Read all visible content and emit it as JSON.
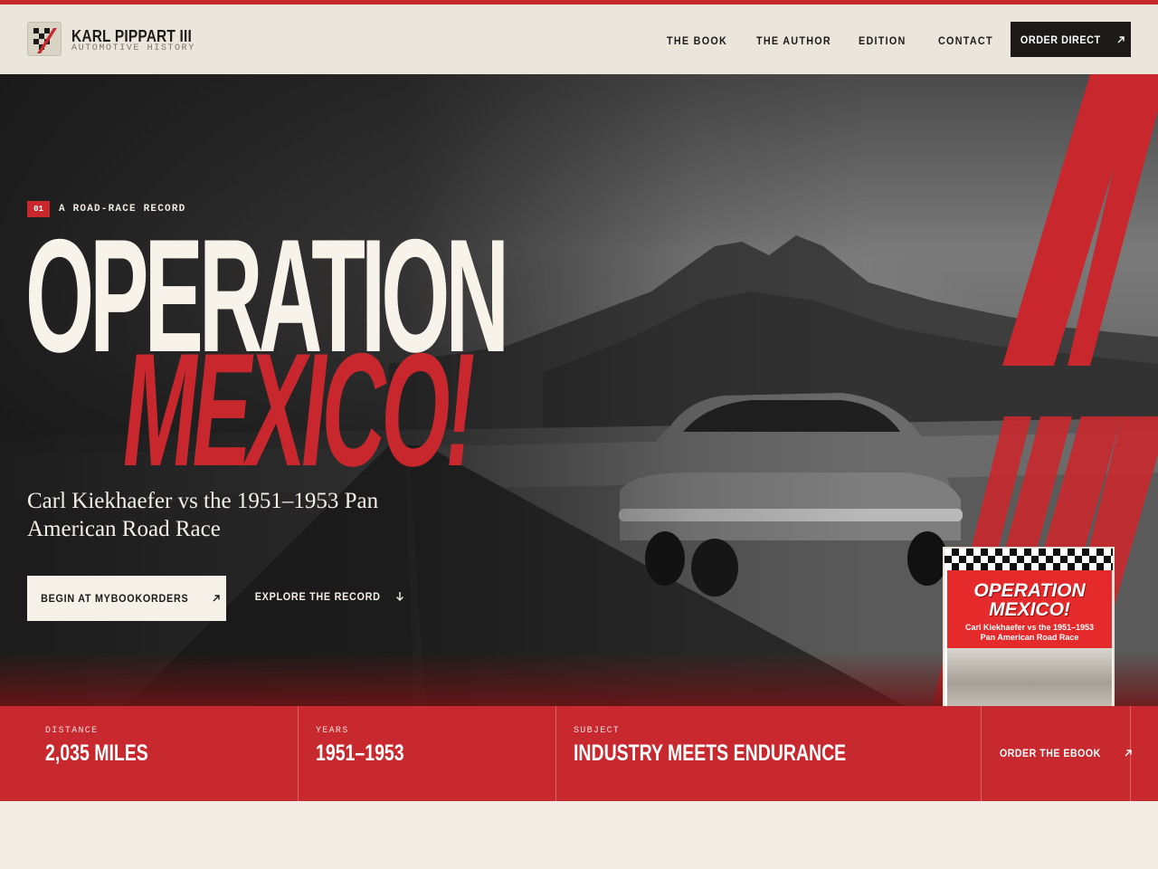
{
  "header": {
    "brand_name": "KARL PIPPART III",
    "brand_sub": "AUTOMOTIVE HISTORY",
    "nav": [
      "THE BOOK",
      "THE AUTHOR",
      "EDITION",
      "CONTACT"
    ],
    "cta": "ORDER DIRECT"
  },
  "hero": {
    "chip_num": "01",
    "chip_text": "A ROAD-RACE RECORD",
    "title_line1": "OPERATION",
    "title_line2": "MEXICO!",
    "subtitle": "Carl Kiekhaefer vs the 1951–1953 Pan American Road Race",
    "primary_button": "BEGIN AT MYBOOKORDERS",
    "secondary_button": "EXPLORE THE RECORD"
  },
  "book": {
    "title_line1": "OPERATION",
    "title_line2": "MEXICO!",
    "subtitle_line1": "Carl Kiekhaefer vs the 1951–1953",
    "subtitle_line2": "Pan American Road Race"
  },
  "stats": [
    {
      "label": "DISTANCE",
      "value": "2,035 MILES"
    },
    {
      "label": "YEARS",
      "value": "1951–1953"
    },
    {
      "label": "SUBJECT",
      "value": "INDUSTRY MEETS ENDURANCE"
    }
  ],
  "ebook_link": "ORDER THE EBOOK",
  "colors": {
    "accent_red": "#c8282d",
    "dark": "#1b1a19",
    "cream": "#f3ece2"
  }
}
